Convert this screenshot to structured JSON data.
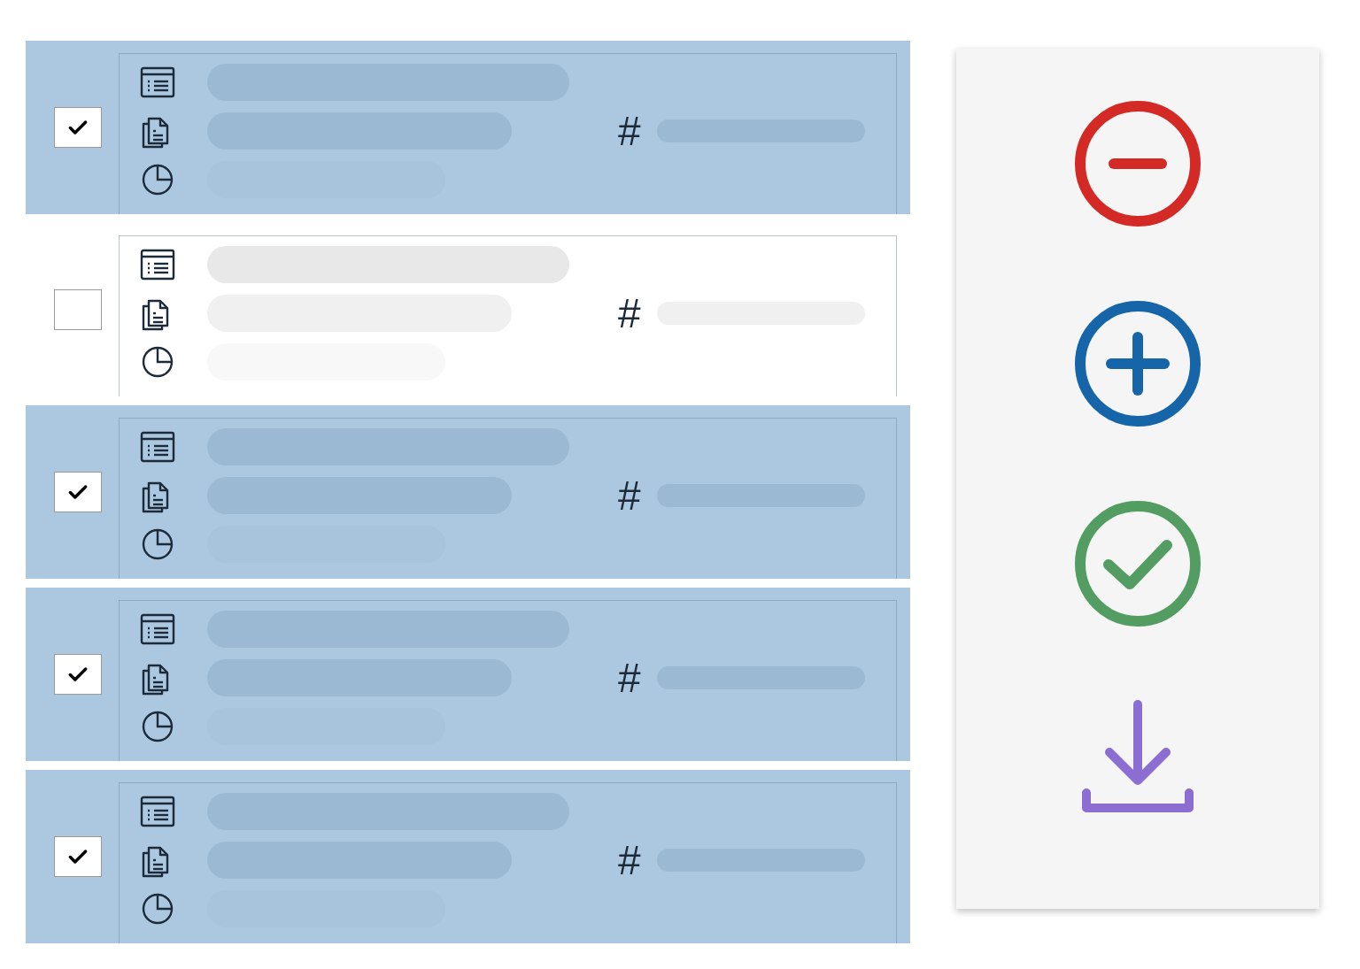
{
  "rows": [
    {
      "selected": true,
      "hash": "#"
    },
    {
      "selected": false,
      "hash": "#"
    },
    {
      "selected": true,
      "hash": "#"
    },
    {
      "selected": true,
      "hash": "#"
    },
    {
      "selected": true,
      "hash": "#"
    }
  ],
  "actions": [
    {
      "kind": "remove",
      "color": "#d32a26"
    },
    {
      "kind": "add",
      "color": "#1565a8"
    },
    {
      "kind": "confirm",
      "color": "#539c62"
    },
    {
      "kind": "download",
      "color": "#8c6dd1"
    }
  ]
}
